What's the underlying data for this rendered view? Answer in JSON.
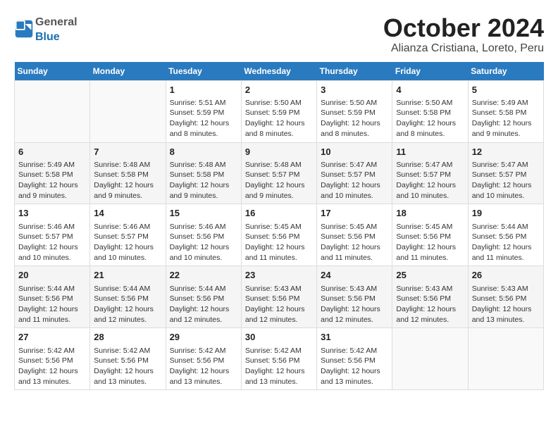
{
  "header": {
    "logo_general": "General",
    "logo_blue": "Blue",
    "month_title": "October 2024",
    "location": "Alianza Cristiana, Loreto, Peru"
  },
  "days_of_week": [
    "Sunday",
    "Monday",
    "Tuesday",
    "Wednesday",
    "Thursday",
    "Friday",
    "Saturday"
  ],
  "weeks": [
    {
      "alt": false,
      "days": [
        {
          "num": "",
          "info": ""
        },
        {
          "num": "",
          "info": ""
        },
        {
          "num": "1",
          "info": "Sunrise: 5:51 AM\nSunset: 5:59 PM\nDaylight: 12 hours and 8 minutes."
        },
        {
          "num": "2",
          "info": "Sunrise: 5:50 AM\nSunset: 5:59 PM\nDaylight: 12 hours and 8 minutes."
        },
        {
          "num": "3",
          "info": "Sunrise: 5:50 AM\nSunset: 5:59 PM\nDaylight: 12 hours and 8 minutes."
        },
        {
          "num": "4",
          "info": "Sunrise: 5:50 AM\nSunset: 5:58 PM\nDaylight: 12 hours and 8 minutes."
        },
        {
          "num": "5",
          "info": "Sunrise: 5:49 AM\nSunset: 5:58 PM\nDaylight: 12 hours and 9 minutes."
        }
      ]
    },
    {
      "alt": true,
      "days": [
        {
          "num": "6",
          "info": "Sunrise: 5:49 AM\nSunset: 5:58 PM\nDaylight: 12 hours and 9 minutes."
        },
        {
          "num": "7",
          "info": "Sunrise: 5:48 AM\nSunset: 5:58 PM\nDaylight: 12 hours and 9 minutes."
        },
        {
          "num": "8",
          "info": "Sunrise: 5:48 AM\nSunset: 5:58 PM\nDaylight: 12 hours and 9 minutes."
        },
        {
          "num": "9",
          "info": "Sunrise: 5:48 AM\nSunset: 5:57 PM\nDaylight: 12 hours and 9 minutes."
        },
        {
          "num": "10",
          "info": "Sunrise: 5:47 AM\nSunset: 5:57 PM\nDaylight: 12 hours and 10 minutes."
        },
        {
          "num": "11",
          "info": "Sunrise: 5:47 AM\nSunset: 5:57 PM\nDaylight: 12 hours and 10 minutes."
        },
        {
          "num": "12",
          "info": "Sunrise: 5:47 AM\nSunset: 5:57 PM\nDaylight: 12 hours and 10 minutes."
        }
      ]
    },
    {
      "alt": false,
      "days": [
        {
          "num": "13",
          "info": "Sunrise: 5:46 AM\nSunset: 5:57 PM\nDaylight: 12 hours and 10 minutes."
        },
        {
          "num": "14",
          "info": "Sunrise: 5:46 AM\nSunset: 5:57 PM\nDaylight: 12 hours and 10 minutes."
        },
        {
          "num": "15",
          "info": "Sunrise: 5:46 AM\nSunset: 5:56 PM\nDaylight: 12 hours and 10 minutes."
        },
        {
          "num": "16",
          "info": "Sunrise: 5:45 AM\nSunset: 5:56 PM\nDaylight: 12 hours and 11 minutes."
        },
        {
          "num": "17",
          "info": "Sunrise: 5:45 AM\nSunset: 5:56 PM\nDaylight: 12 hours and 11 minutes."
        },
        {
          "num": "18",
          "info": "Sunrise: 5:45 AM\nSunset: 5:56 PM\nDaylight: 12 hours and 11 minutes."
        },
        {
          "num": "19",
          "info": "Sunrise: 5:44 AM\nSunset: 5:56 PM\nDaylight: 12 hours and 11 minutes."
        }
      ]
    },
    {
      "alt": true,
      "days": [
        {
          "num": "20",
          "info": "Sunrise: 5:44 AM\nSunset: 5:56 PM\nDaylight: 12 hours and 11 minutes."
        },
        {
          "num": "21",
          "info": "Sunrise: 5:44 AM\nSunset: 5:56 PM\nDaylight: 12 hours and 12 minutes."
        },
        {
          "num": "22",
          "info": "Sunrise: 5:44 AM\nSunset: 5:56 PM\nDaylight: 12 hours and 12 minutes."
        },
        {
          "num": "23",
          "info": "Sunrise: 5:43 AM\nSunset: 5:56 PM\nDaylight: 12 hours and 12 minutes."
        },
        {
          "num": "24",
          "info": "Sunrise: 5:43 AM\nSunset: 5:56 PM\nDaylight: 12 hours and 12 minutes."
        },
        {
          "num": "25",
          "info": "Sunrise: 5:43 AM\nSunset: 5:56 PM\nDaylight: 12 hours and 12 minutes."
        },
        {
          "num": "26",
          "info": "Sunrise: 5:43 AM\nSunset: 5:56 PM\nDaylight: 12 hours and 13 minutes."
        }
      ]
    },
    {
      "alt": false,
      "days": [
        {
          "num": "27",
          "info": "Sunrise: 5:42 AM\nSunset: 5:56 PM\nDaylight: 12 hours and 13 minutes."
        },
        {
          "num": "28",
          "info": "Sunrise: 5:42 AM\nSunset: 5:56 PM\nDaylight: 12 hours and 13 minutes."
        },
        {
          "num": "29",
          "info": "Sunrise: 5:42 AM\nSunset: 5:56 PM\nDaylight: 12 hours and 13 minutes."
        },
        {
          "num": "30",
          "info": "Sunrise: 5:42 AM\nSunset: 5:56 PM\nDaylight: 12 hours and 13 minutes."
        },
        {
          "num": "31",
          "info": "Sunrise: 5:42 AM\nSunset: 5:56 PM\nDaylight: 12 hours and 13 minutes."
        },
        {
          "num": "",
          "info": ""
        },
        {
          "num": "",
          "info": ""
        }
      ]
    }
  ]
}
